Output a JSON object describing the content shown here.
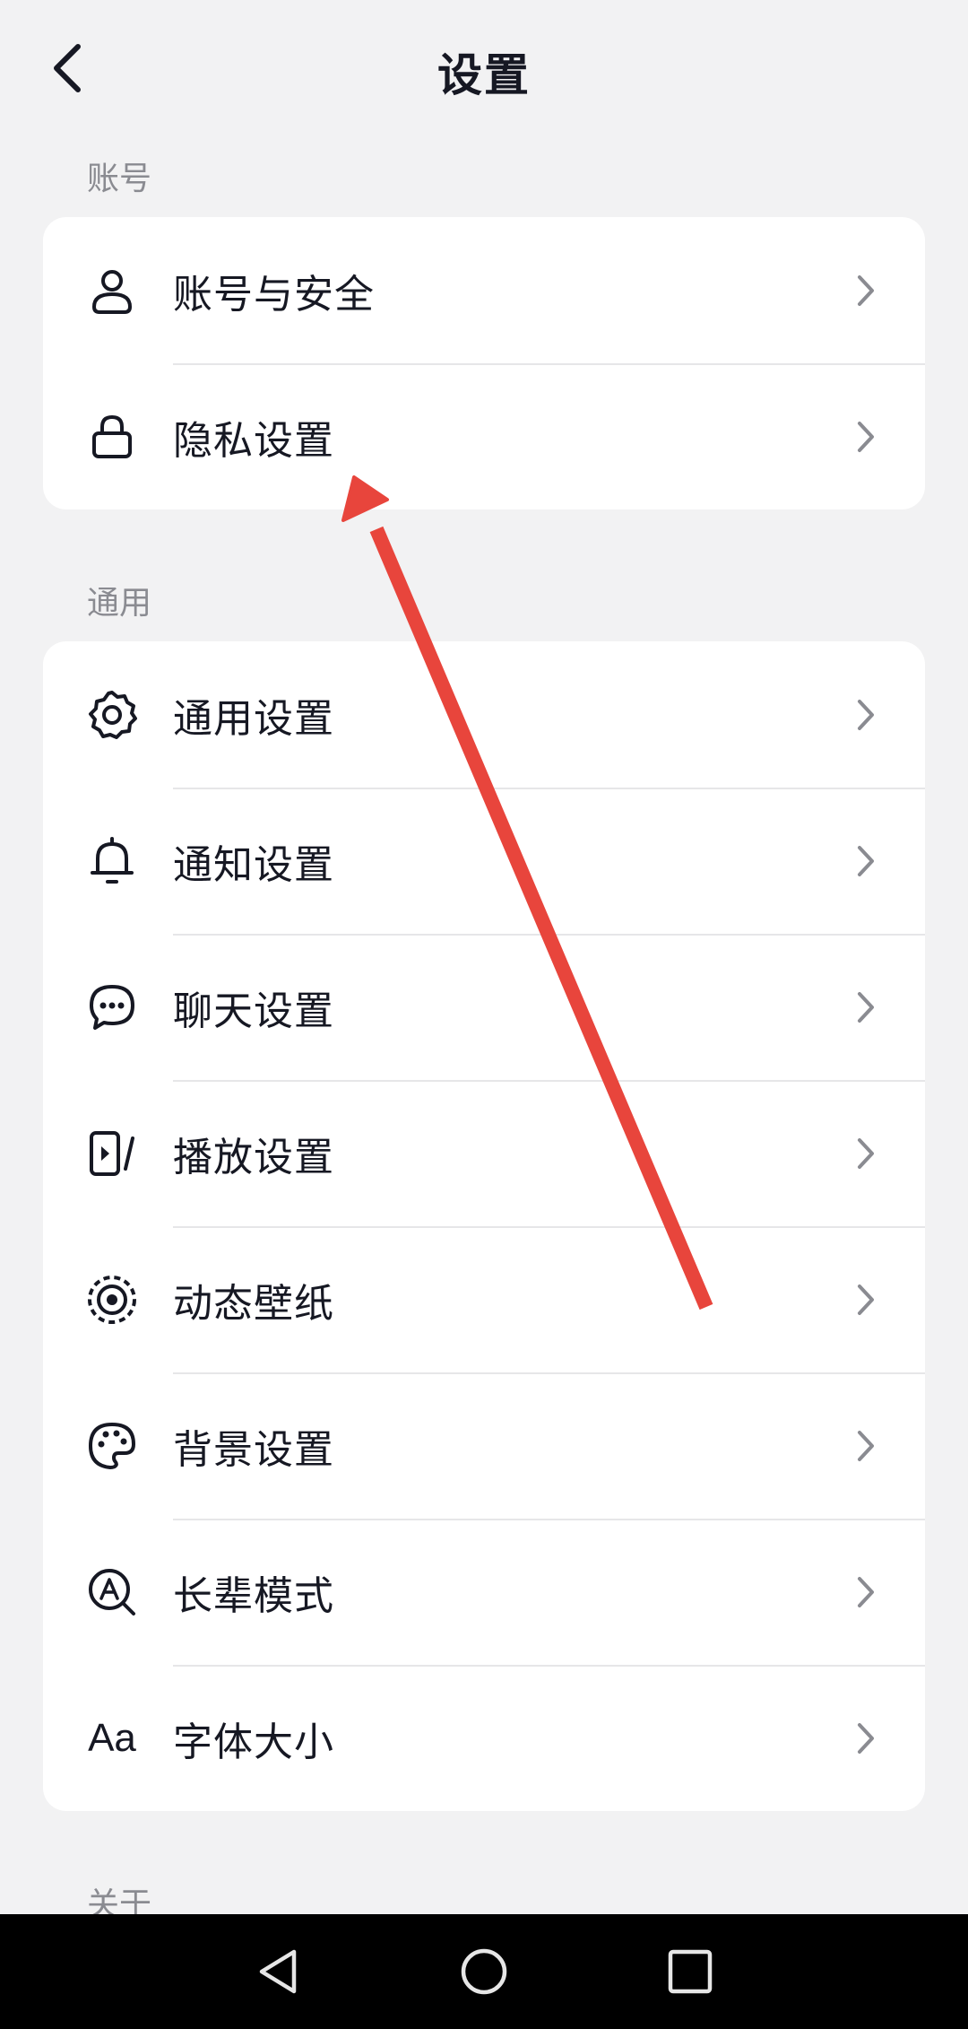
{
  "header": {
    "title": "设置"
  },
  "sections": [
    {
      "label": "账号",
      "items": [
        {
          "label": "账号与安全",
          "icon": "user-icon"
        },
        {
          "label": "隐私设置",
          "icon": "lock-icon"
        }
      ]
    },
    {
      "label": "通用",
      "items": [
        {
          "label": "通用设置",
          "icon": "gear-icon"
        },
        {
          "label": "通知设置",
          "icon": "bell-icon"
        },
        {
          "label": "聊天设置",
          "icon": "chat-bubble-icon"
        },
        {
          "label": "播放设置",
          "icon": "playback-icon"
        },
        {
          "label": "动态壁纸",
          "icon": "live-wallpaper-icon"
        },
        {
          "label": "背景设置",
          "icon": "palette-icon"
        },
        {
          "label": "长辈模式",
          "icon": "elder-mode-icon"
        },
        {
          "label": "字体大小",
          "icon": "font-size-icon",
          "icon_text": "Aa"
        }
      ]
    },
    {
      "label": "关于"
    }
  ],
  "annotation": {
    "color": "#e8453c"
  },
  "navbar": {
    "buttons": [
      "back-triangle-icon",
      "home-circle-icon",
      "recents-square-icon"
    ]
  }
}
